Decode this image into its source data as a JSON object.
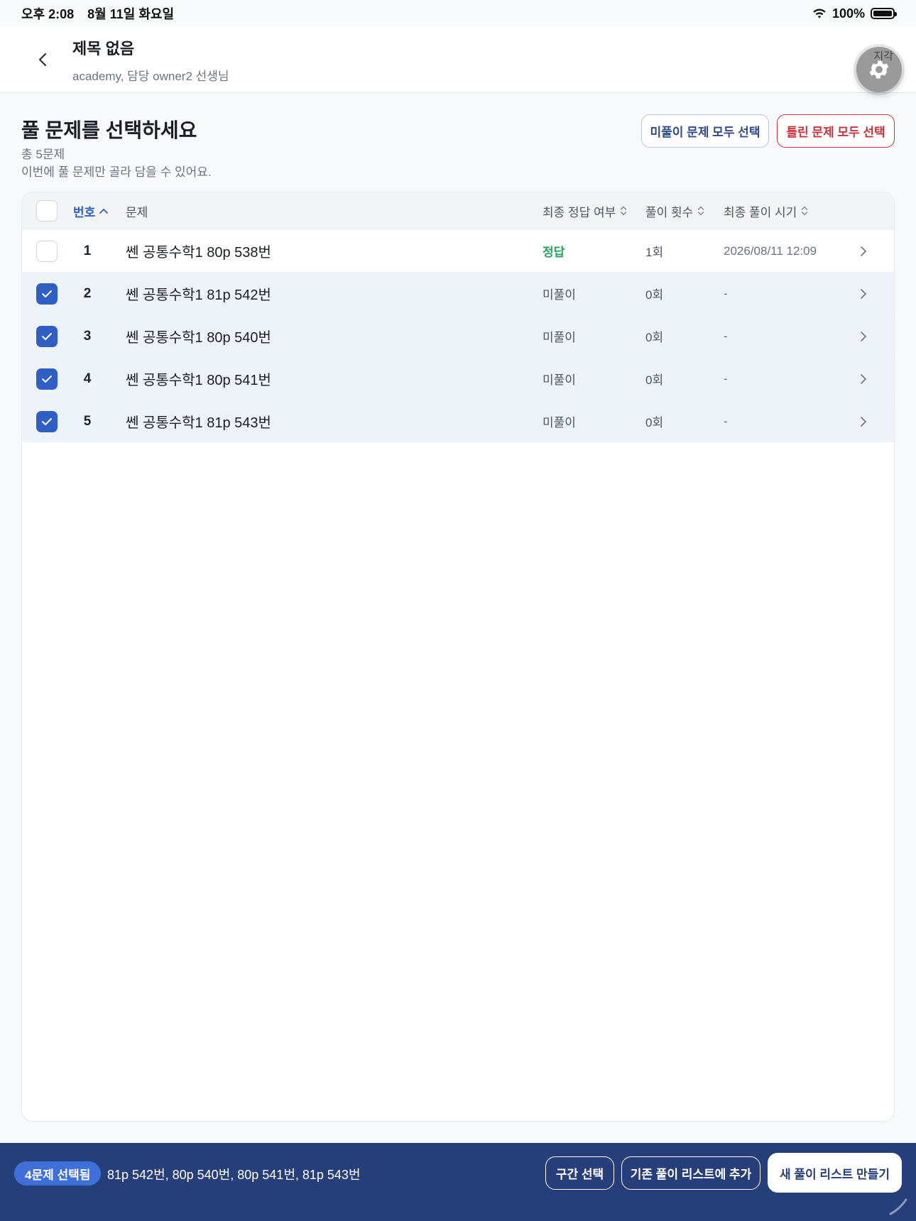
{
  "status_bar": {
    "time": "오후 2:08",
    "date": "8월 11일 화요일",
    "battery": "100%"
  },
  "header": {
    "title": "제목 없음",
    "subtitle": "academy, 담당 owner2 선생님",
    "settings_label": "지각"
  },
  "section": {
    "title": "풀 문제를 선택하세요",
    "total": "총 5문제",
    "description": "이번에 풀 문제만 골라 담을 수 있어요."
  },
  "actions": {
    "select_unsolved": "미풀이 문제 모두 선택",
    "select_wrong": "틀린 문제 모두 선택"
  },
  "table": {
    "columns": {
      "number": "번호",
      "problem": "문제",
      "status": "최종 정답 여부",
      "count": "풀이 횟수",
      "date": "최종 풀이 시기"
    },
    "rows": [
      {
        "number": "1",
        "problem": "쎈 공통수학1 80p 538번",
        "status": "정답",
        "count": "1회",
        "date": "2026/08/11 12:09",
        "checked": false
      },
      {
        "number": "2",
        "problem": "쎈 공통수학1 81p 542번",
        "status": "미풀이",
        "count": "0회",
        "date": "-",
        "checked": true
      },
      {
        "number": "3",
        "problem": "쎈 공통수학1 80p 540번",
        "status": "미풀이",
        "count": "0회",
        "date": "-",
        "checked": true
      },
      {
        "number": "4",
        "problem": "쎈 공통수학1 80p 541번",
        "status": "미풀이",
        "count": "0회",
        "date": "-",
        "checked": true
      },
      {
        "number": "5",
        "problem": "쎈 공통수학1 81p 543번",
        "status": "미풀이",
        "count": "0회",
        "date": "-",
        "checked": true
      }
    ]
  },
  "bottom_bar": {
    "selected_badge": "4문제 선택됨",
    "selected_list": "81p 542번, 80p 540번, 80p 541번, 81p 543번",
    "range_select": "구간 선택",
    "add_existing": "기존 풀이 리스트에 추가",
    "create_new": "새 풀이 리스트 만들기"
  },
  "colors": {
    "accent": "#2f5ec4",
    "bottom_bar": "#263f7a",
    "correct": "#22a45d",
    "wrong": "#c8343d"
  }
}
